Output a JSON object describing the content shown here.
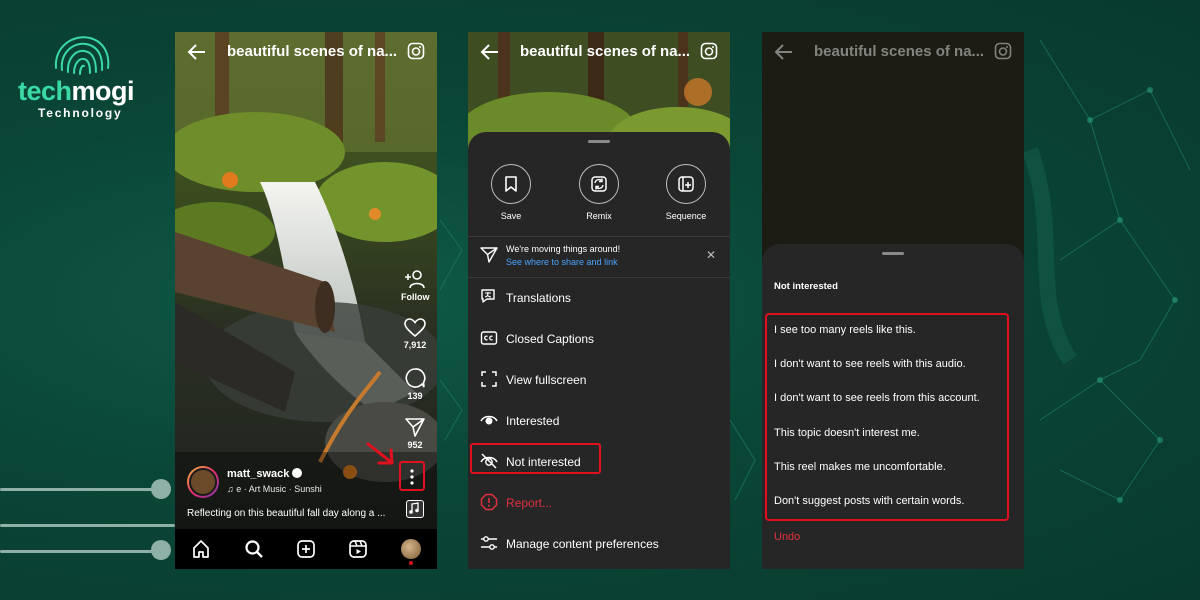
{
  "brand": {
    "name_part1": "tech",
    "name_part2": "mogi",
    "tagline": "Technology",
    "accent_color": "#3ad9a5"
  },
  "reel": {
    "title": "beautiful scenes of na...",
    "follow_label": "Follow",
    "likes": "7,912",
    "comments": "139",
    "shares": "952",
    "username": "matt_swack",
    "music": "e · Art Music · Sunshi",
    "caption": "Reflecting on this beautiful fall day along a ..."
  },
  "bottom_nav": [
    "home-icon",
    "search-icon",
    "create-icon",
    "reels-icon",
    "profile-avatar"
  ],
  "options_sheet": {
    "quick_actions": [
      {
        "label": "Save",
        "icon": "bookmark-icon"
      },
      {
        "label": "Remix",
        "icon": "remix-icon"
      },
      {
        "label": "Sequence",
        "icon": "sequence-icon"
      }
    ],
    "notice_line1": "We're moving things around!",
    "notice_line2": "See where to share and link",
    "close_glyph": "✕",
    "items": [
      {
        "label": "Translations",
        "icon": "translate-icon"
      },
      {
        "label": "Closed Captions",
        "icon": "captions-icon"
      },
      {
        "label": "View fullscreen",
        "icon": "fullscreen-icon"
      },
      {
        "label": "Interested",
        "icon": "eye-icon"
      },
      {
        "label": "Not interested",
        "icon": "eye-off-icon"
      },
      {
        "label": "Report...",
        "icon": "report-icon"
      },
      {
        "label": "Manage content preferences",
        "icon": "sliders-icon"
      }
    ]
  },
  "not_interested_sheet": {
    "heading": "Not interested",
    "reasons": [
      "I see too many reels like this.",
      "I don't want to see reels with this audio.",
      "I don't want to see reels from this account.",
      "This topic doesn't interest me.",
      "This reel makes me uncomfortable.",
      "Don't suggest posts with certain words."
    ],
    "undo_label": "Undo"
  },
  "colors": {
    "highlight": "#e0101f",
    "danger_text": "#e0303f",
    "link": "#4aa3ff",
    "sheet_bg": "#262626"
  }
}
